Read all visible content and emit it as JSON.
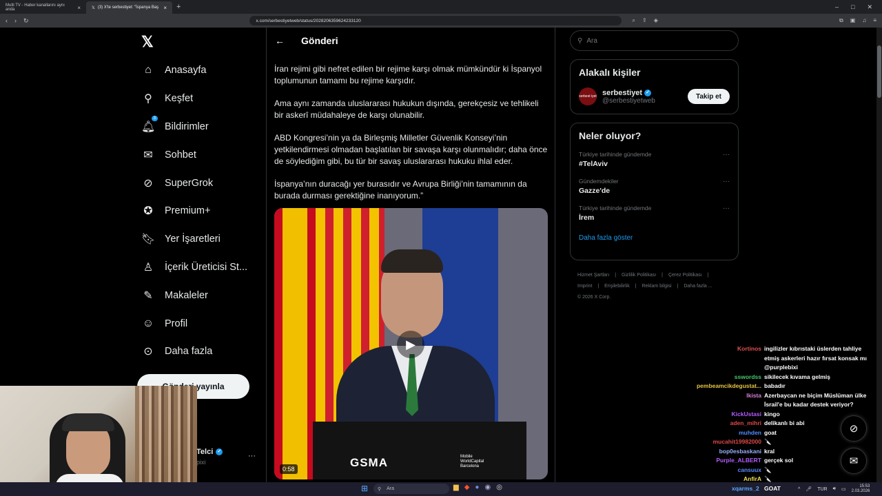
{
  "browser": {
    "tabs": [
      {
        "label": "Multi TV - Haber kanallarını aynı anda"
      },
      {
        "label": "(3) X'te serbestiyet: \"İspanya Baş"
      }
    ],
    "url": "x.com/serbestiyetweb/status/2028206359624233120"
  },
  "nav": {
    "items": [
      {
        "label": "Anasayfa",
        "icon": "home-icon"
      },
      {
        "label": "Keşfet",
        "icon": "search-icon"
      },
      {
        "label": "Bildirimler",
        "icon": "bell-icon",
        "badge": "3"
      },
      {
        "label": "Sohbet",
        "icon": "mail-icon"
      },
      {
        "label": "SuperGrok",
        "icon": "grok-icon"
      },
      {
        "label": "Premium+",
        "icon": "verified-icon"
      },
      {
        "label": "Yer İşaretleri",
        "icon": "bookmark-icon"
      },
      {
        "label": "İçerik Üreticisi St...",
        "icon": "creator-icon"
      },
      {
        "label": "Makaleler",
        "icon": "article-icon"
      },
      {
        "label": "Profil",
        "icon": "profile-icon"
      },
      {
        "label": "Daha fazla",
        "icon": "more-icon"
      }
    ],
    "post_button": "Gönderi yayınla",
    "account": {
      "name": "Telci",
      "handle": "pixi"
    }
  },
  "post": {
    "header": "Gönderi",
    "paragraphs": [
      "İran rejimi gibi nefret edilen bir rejime karşı olmak mümkündür ki İspanyol toplumunun tamamı bu rejime karşıdır.",
      "Ama aynı zamanda uluslararası hukukun dışında, gerekçesiz ve tehlikeli bir askerî müdahaleye de karşı olunabilir.",
      "ABD Kongresi’nin ya da Birleşmiş Milletler Güvenlik Konseyi’nin yetkilendirmesi olmadan başlatılan bir savaşa karşı olunmalıdır; daha önce de söylediğim gibi, bu tür bir savaş uluslararası hukuku ihlal eder.",
      "İspanya’nın duracağı yer burasıdır ve Avrupa Birliği’nin tamamının da burada durması gerektiğine inanıyorum.”"
    ],
    "video": {
      "duration": "0:58",
      "brand": "GSMA",
      "event_lines": [
        "Mobile",
        "WorldCapital",
        "Barcelona"
      ]
    }
  },
  "sidebar": {
    "search_placeholder": "Ara",
    "related": {
      "title": "Alakalı kişiler",
      "person": {
        "name": "serbestiyet",
        "handle": "@serbestiyetweb",
        "follow_label": "Takip et",
        "avatar_text": "serbest iyet"
      }
    },
    "trends": {
      "title": "Neler oluyor?",
      "items": [
        {
          "context": "Türkiye tarihinde gündemde",
          "name": "#TelAviv"
        },
        {
          "context": "Gündemdekiler",
          "name": "Gazze'de"
        },
        {
          "context": "Türkiye tarihinde gündemde",
          "name": "İrem"
        }
      ],
      "show_more": "Daha fazla göster"
    },
    "footer": {
      "links": [
        "Hizmet Şartları",
        "|",
        "Gizlilik Politikası",
        "|",
        "Çerez Politikası",
        "|",
        "Imprint",
        "|",
        "Erişilebilirlik",
        "|",
        "Reklam bilgisi",
        "|",
        "Daha fazla ..."
      ],
      "copyright": "© 2026 X Corp."
    }
  },
  "chat": {
    "messages": [
      {
        "user": "Kortinos",
        "color": "#e05050",
        "text": "ingilizler kıbrıstaki üslerden tahliye"
      },
      {
        "user": "",
        "color": "#ffffff",
        "text": "etmiş askerleri hazır fırsat konsak mı"
      },
      {
        "user": "",
        "color": "#ffffff",
        "text": "@purplebixi"
      },
      {
        "user": "sswordss",
        "color": "#45c96a",
        "text": "sikilecek kıvama gelmiş"
      },
      {
        "user": "pembeamcikdegustat...",
        "color": "#e8c542",
        "text": "babadır"
      },
      {
        "user": "Ikista",
        "color": "#d580d5",
        "text": "Azerbaycan ne biçim Müslüman ülke"
      },
      {
        "user": "",
        "color": "#ffffff",
        "text": "İsrail'e bu kadar destek veriyor?"
      },
      {
        "user": "KickUstasi",
        "color": "#b55cff",
        "text": "kingo"
      },
      {
        "user": "aden_mihri",
        "color": "#e04848",
        "text": "delikanlı bi abi"
      },
      {
        "user": "muhden",
        "color": "#4f8cff",
        "text": "goat"
      },
      {
        "user": "mucahit19982000",
        "color": "#e04848",
        "text": "🔪"
      },
      {
        "user": "bop0esbaskani",
        "color": "#9ab0ff",
        "text": "kral"
      },
      {
        "user": "Purple_ALBERT",
        "color": "#b55cff",
        "text": "gerçek sol"
      },
      {
        "user": "cansuux",
        "color": "#5a8cff",
        "text": "🔪"
      },
      {
        "user": "AnfirA",
        "color": "#f0e050",
        "text": "🔪"
      }
    ],
    "last_user": "xqarms_2",
    "last_msg": "GOAT"
  },
  "taskbar": {
    "search_label": "Ara",
    "lang": "TUR",
    "time": "15:53",
    "date": "2.03.2026"
  },
  "colors": {
    "accent": "#1d9bf0",
    "background": "#000000"
  }
}
